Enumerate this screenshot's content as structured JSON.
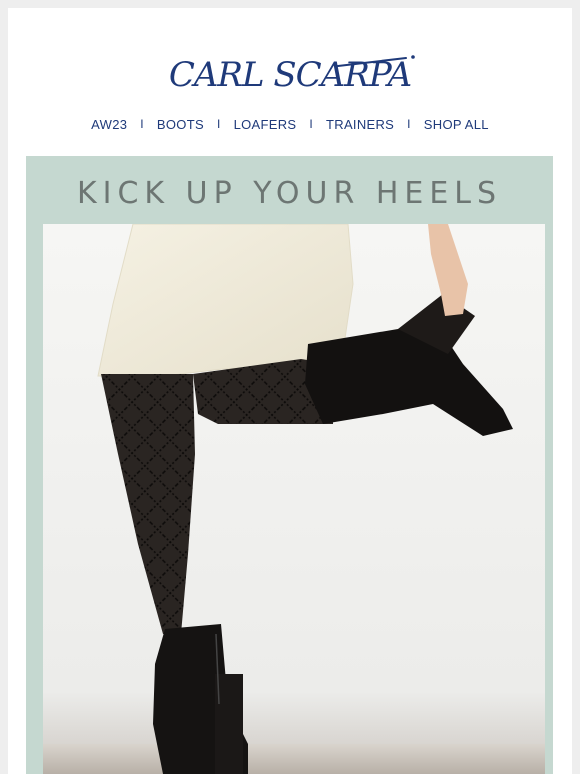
{
  "brand": {
    "logo_text": "CARL SCARPA"
  },
  "nav": {
    "items": [
      {
        "label": "AW23"
      },
      {
        "label": "BOOTS"
      },
      {
        "label": "LOAFERS"
      },
      {
        "label": "TRAINERS"
      },
      {
        "label": "SHOP ALL"
      }
    ],
    "separator": "I"
  },
  "hero": {
    "headline": "KICK UP YOUR HEELS",
    "image_subject": "woman in cream skirt, patterned black tights and black heeled ankle boots"
  },
  "colors": {
    "brand_navy": "#1f3a7a",
    "hero_background": "#c5d8d0",
    "headline_text": "#6d7673"
  }
}
